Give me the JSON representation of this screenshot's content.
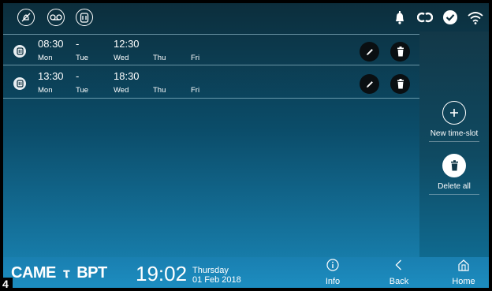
{
  "colors": {
    "accent": "#1a87b8",
    "panel": "#123848"
  },
  "topbar": {
    "mode_icons": [
      "no-bell-icon",
      "voicemail-icon",
      "door-phone-icon"
    ],
    "status_icons": [
      "bell-icon",
      "link-icon",
      "check-icon",
      "wifi-icon"
    ]
  },
  "slots": [
    {
      "start": "08:30",
      "separator": "-",
      "end": "12:30",
      "days": [
        "Mon",
        "Tue",
        "Wed",
        "Thu",
        "Fri"
      ]
    },
    {
      "start": "13:30",
      "separator": "-",
      "end": "18:30",
      "days": [
        "Mon",
        "Tue",
        "Wed",
        "Thu",
        "Fri"
      ]
    }
  ],
  "side": {
    "new_label": "New time-slot",
    "delete_label": "Delete all"
  },
  "bottom": {
    "logo": "CAME",
    "logo2": "BPT",
    "logo_mark": "ⲧ",
    "time": "19:02",
    "day": "Thursday",
    "date": "01 Feb 2018",
    "info_label": "Info",
    "back_label": "Back",
    "home_label": "Home"
  },
  "badge": "4"
}
